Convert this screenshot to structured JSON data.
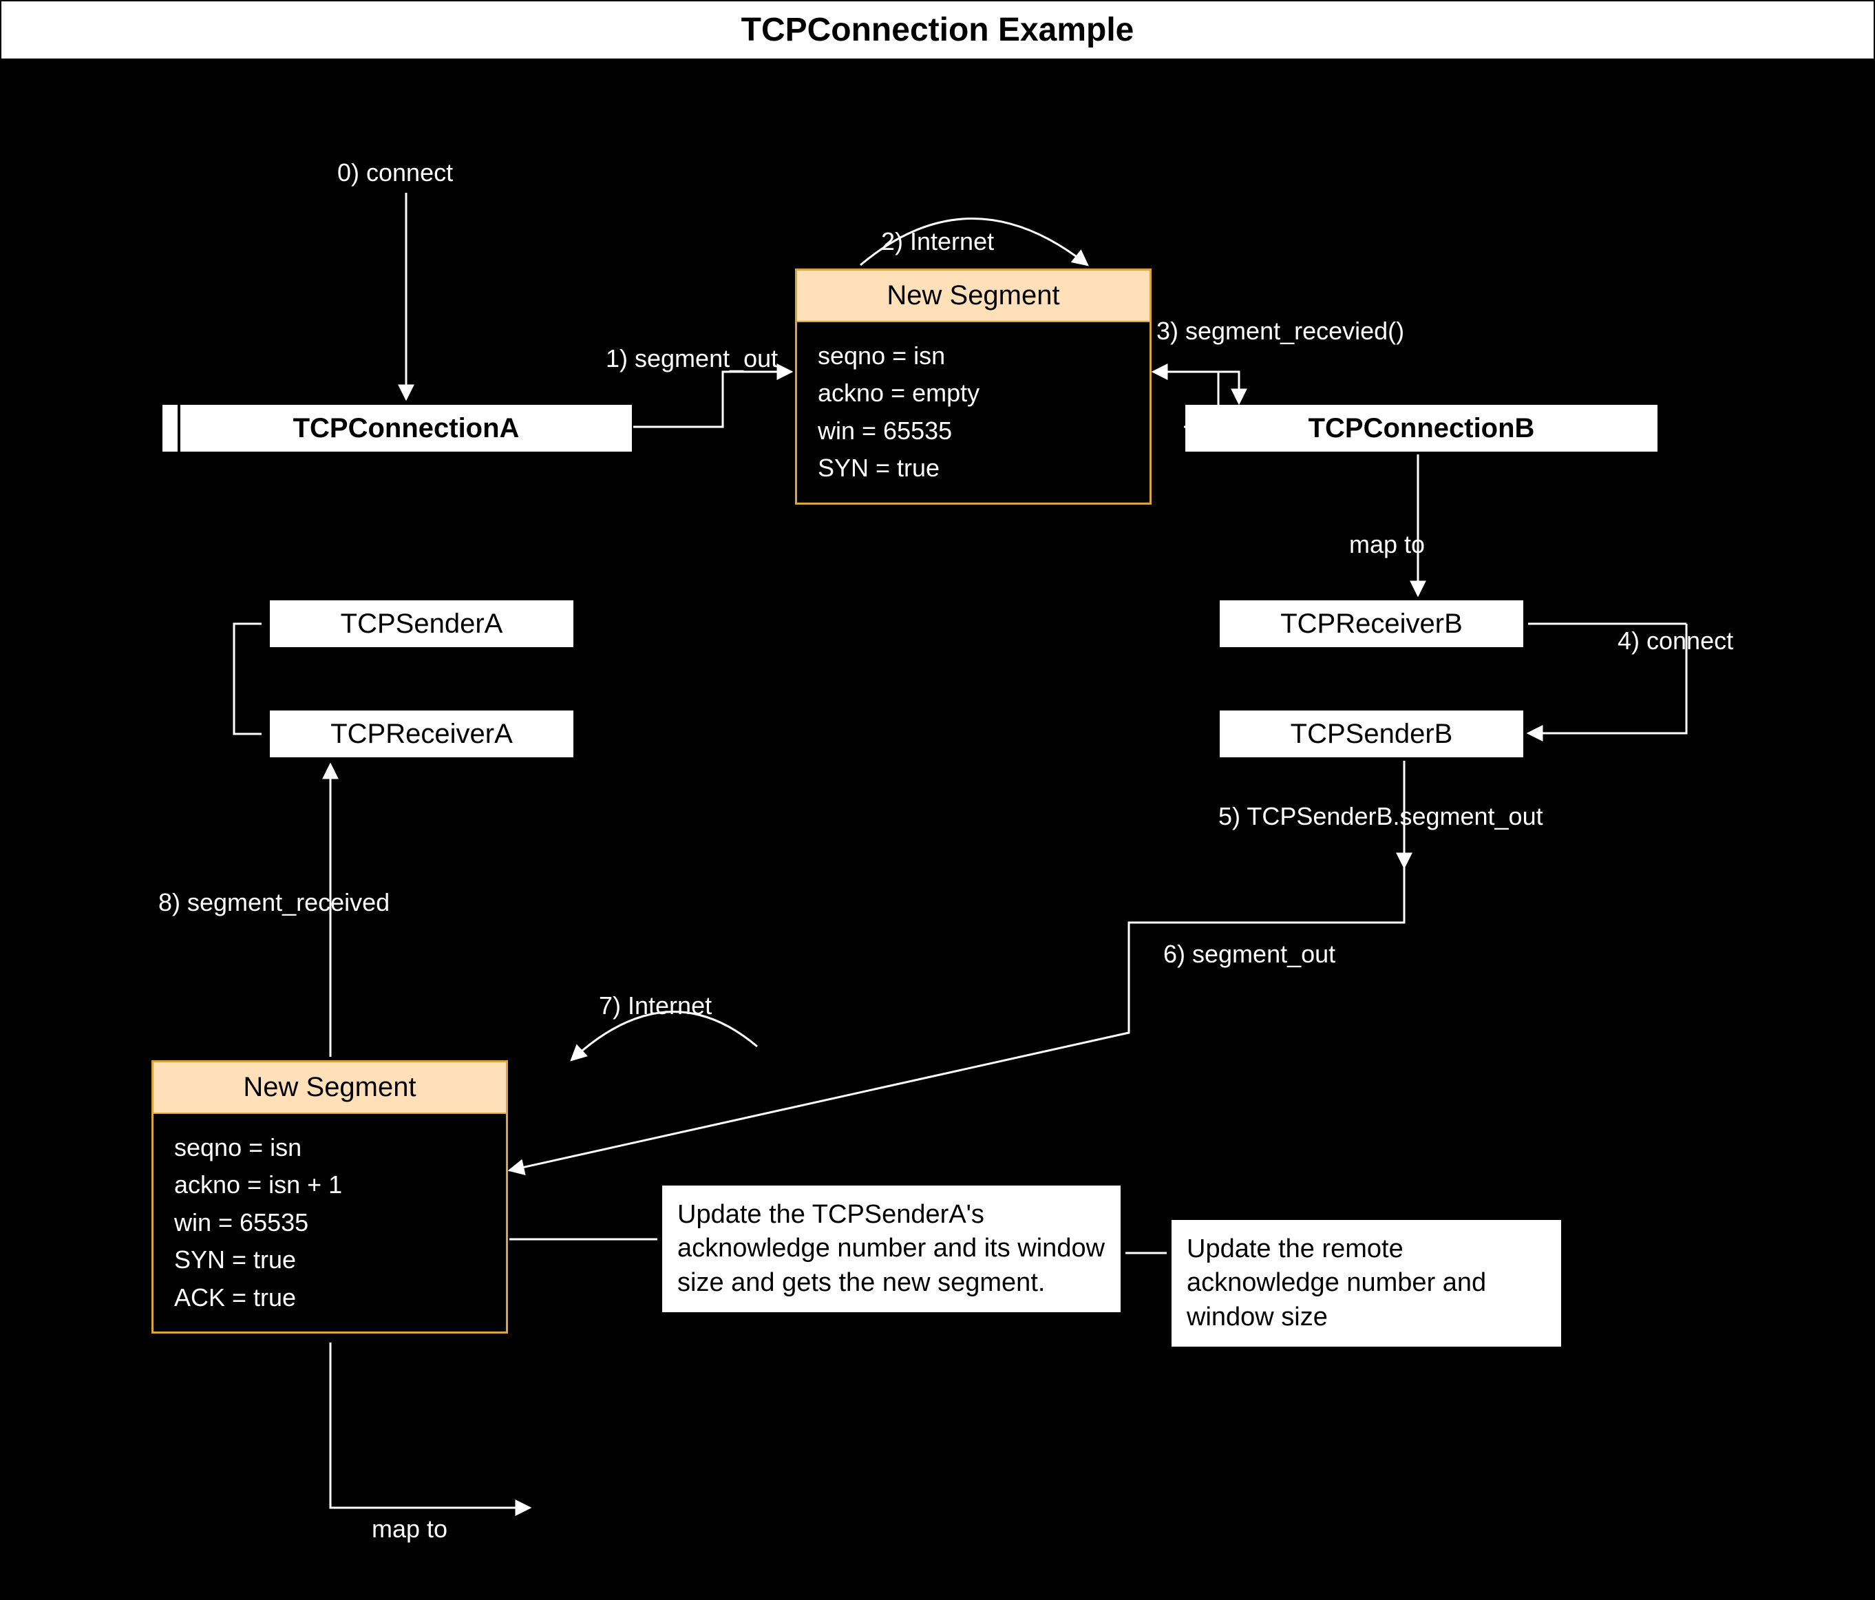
{
  "title": "TCPConnection Example",
  "connA": {
    "name": "TCPConnectionA",
    "sender": "TCPSenderA",
    "receiver": "TCPReceiverA"
  },
  "connB": {
    "name": "TCPConnectionB",
    "receiver": "TCPReceiverB",
    "sender": "TCPSenderB"
  },
  "segment1": {
    "title": "New Segment",
    "seqno": "seqno = isn",
    "ackno": "ackno = empty",
    "win": "win = 65535",
    "syn": "SYN = true"
  },
  "segment2": {
    "title": "New Segment",
    "seqno": "seqno = isn",
    "ackno": "ackno = isn + 1",
    "win": "win = 65535",
    "syn": "SYN = true",
    "ack": "ACK = true"
  },
  "steps": {
    "s0": "0) connect",
    "s1": "1) segment_out",
    "s2": "2) Internet",
    "s3": "3) segment_recevied()",
    "s4": "map to",
    "s5": "4) connect",
    "s6": "5) TCPSenderB.segment_out",
    "s7": "6) segment_out",
    "s8": "7) Internet",
    "s9": "8) segment_received"
  },
  "notes": {
    "n1": "Update the TCPSenderA's acknowledge number and its window size and gets the new segment.",
    "n2": "Update the remote acknowledge number and window size"
  }
}
